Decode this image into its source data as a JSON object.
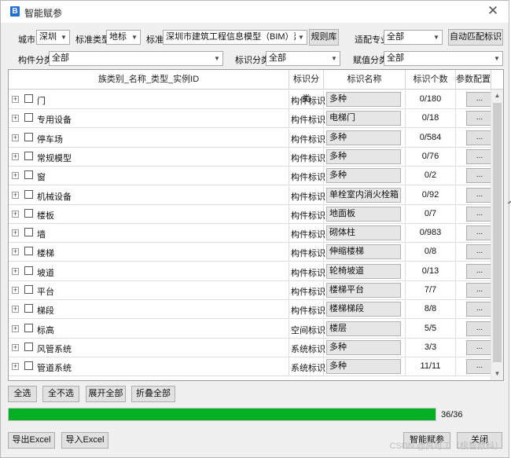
{
  "window": {
    "title": "智能赋参",
    "icon": "app-logo-icon",
    "close_glyph": "✕"
  },
  "filters": {
    "city_label": "城市",
    "city_value": "深圳",
    "std_type_label": "标准类型",
    "std_type_value": "地标",
    "standard_label": "标准",
    "standard_value": "深圳市建筑工程信息模型（BIM）建模手",
    "rules_button": "规则库",
    "discipline_label": "适配专业",
    "discipline_value": "全部",
    "auto_match_button": "自动匹配标识",
    "component_category_label": "构件分类",
    "component_category_value": "全部",
    "mark_category_label": "标识分类",
    "mark_category_value": "全部",
    "value_category_label": "赋值分类",
    "value_category_value": "全部"
  },
  "table": {
    "headers": [
      "族类别_名称_类型_实例ID",
      "标识分类",
      "标识名称",
      "标识个数",
      "参数配置"
    ],
    "config_button_label": "...",
    "rows": [
      {
        "name": "门",
        "mark_category": "构件标识",
        "mark_name": "多种",
        "count": "0/180"
      },
      {
        "name": "专用设备",
        "mark_category": "构件标识",
        "mark_name": "电梯门",
        "count": "0/18"
      },
      {
        "name": "停车场",
        "mark_category": "构件标识",
        "mark_name": "多种",
        "count": "0/584"
      },
      {
        "name": "常规模型",
        "mark_category": "构件标识",
        "mark_name": "多种",
        "count": "0/76"
      },
      {
        "name": "窗",
        "mark_category": "构件标识",
        "mark_name": "多种",
        "count": "0/2"
      },
      {
        "name": "机械设备",
        "mark_category": "构件标识",
        "mark_name": "单栓室内消火栓箱",
        "count": "0/92"
      },
      {
        "name": "楼板",
        "mark_category": "构件标识",
        "mark_name": "地面板",
        "count": "0/7"
      },
      {
        "name": "墙",
        "mark_category": "构件标识",
        "mark_name": "砌体柱",
        "count": "0/983"
      },
      {
        "name": "楼梯",
        "mark_category": "构件标识",
        "mark_name": "伸缩楼梯",
        "count": "0/8"
      },
      {
        "name": "坡道",
        "mark_category": "构件标识",
        "mark_name": "轮椅坡道",
        "count": "0/13"
      },
      {
        "name": "平台",
        "mark_category": "构件标识",
        "mark_name": "楼梯平台",
        "count": "7/7"
      },
      {
        "name": "梯段",
        "mark_category": "构件标识",
        "mark_name": "楼梯梯段",
        "count": "8/8"
      },
      {
        "name": "标高",
        "mark_category": "空间标识",
        "mark_name": "楼层",
        "count": "5/5"
      },
      {
        "name": "风管系统",
        "mark_category": "系统标识",
        "mark_name": "多种",
        "count": "3/3"
      },
      {
        "name": "管道系统",
        "mark_category": "系统标识",
        "mark_name": "多种",
        "count": "11/11"
      }
    ]
  },
  "actions": {
    "select_all": "全选",
    "select_none": "全不选",
    "expand_all": "展开全部",
    "collapse_all": "折叠全部",
    "export_excel": "导出Excel",
    "import_excel": "导入Excel",
    "smart_assign": "智能赋参",
    "close": "关闭"
  },
  "progress": {
    "value": 1.0,
    "text": "36/36",
    "color": "#06b025"
  },
  "watermark": "CSDN @高可工（极智数科）",
  "edge_mark": "ノ"
}
